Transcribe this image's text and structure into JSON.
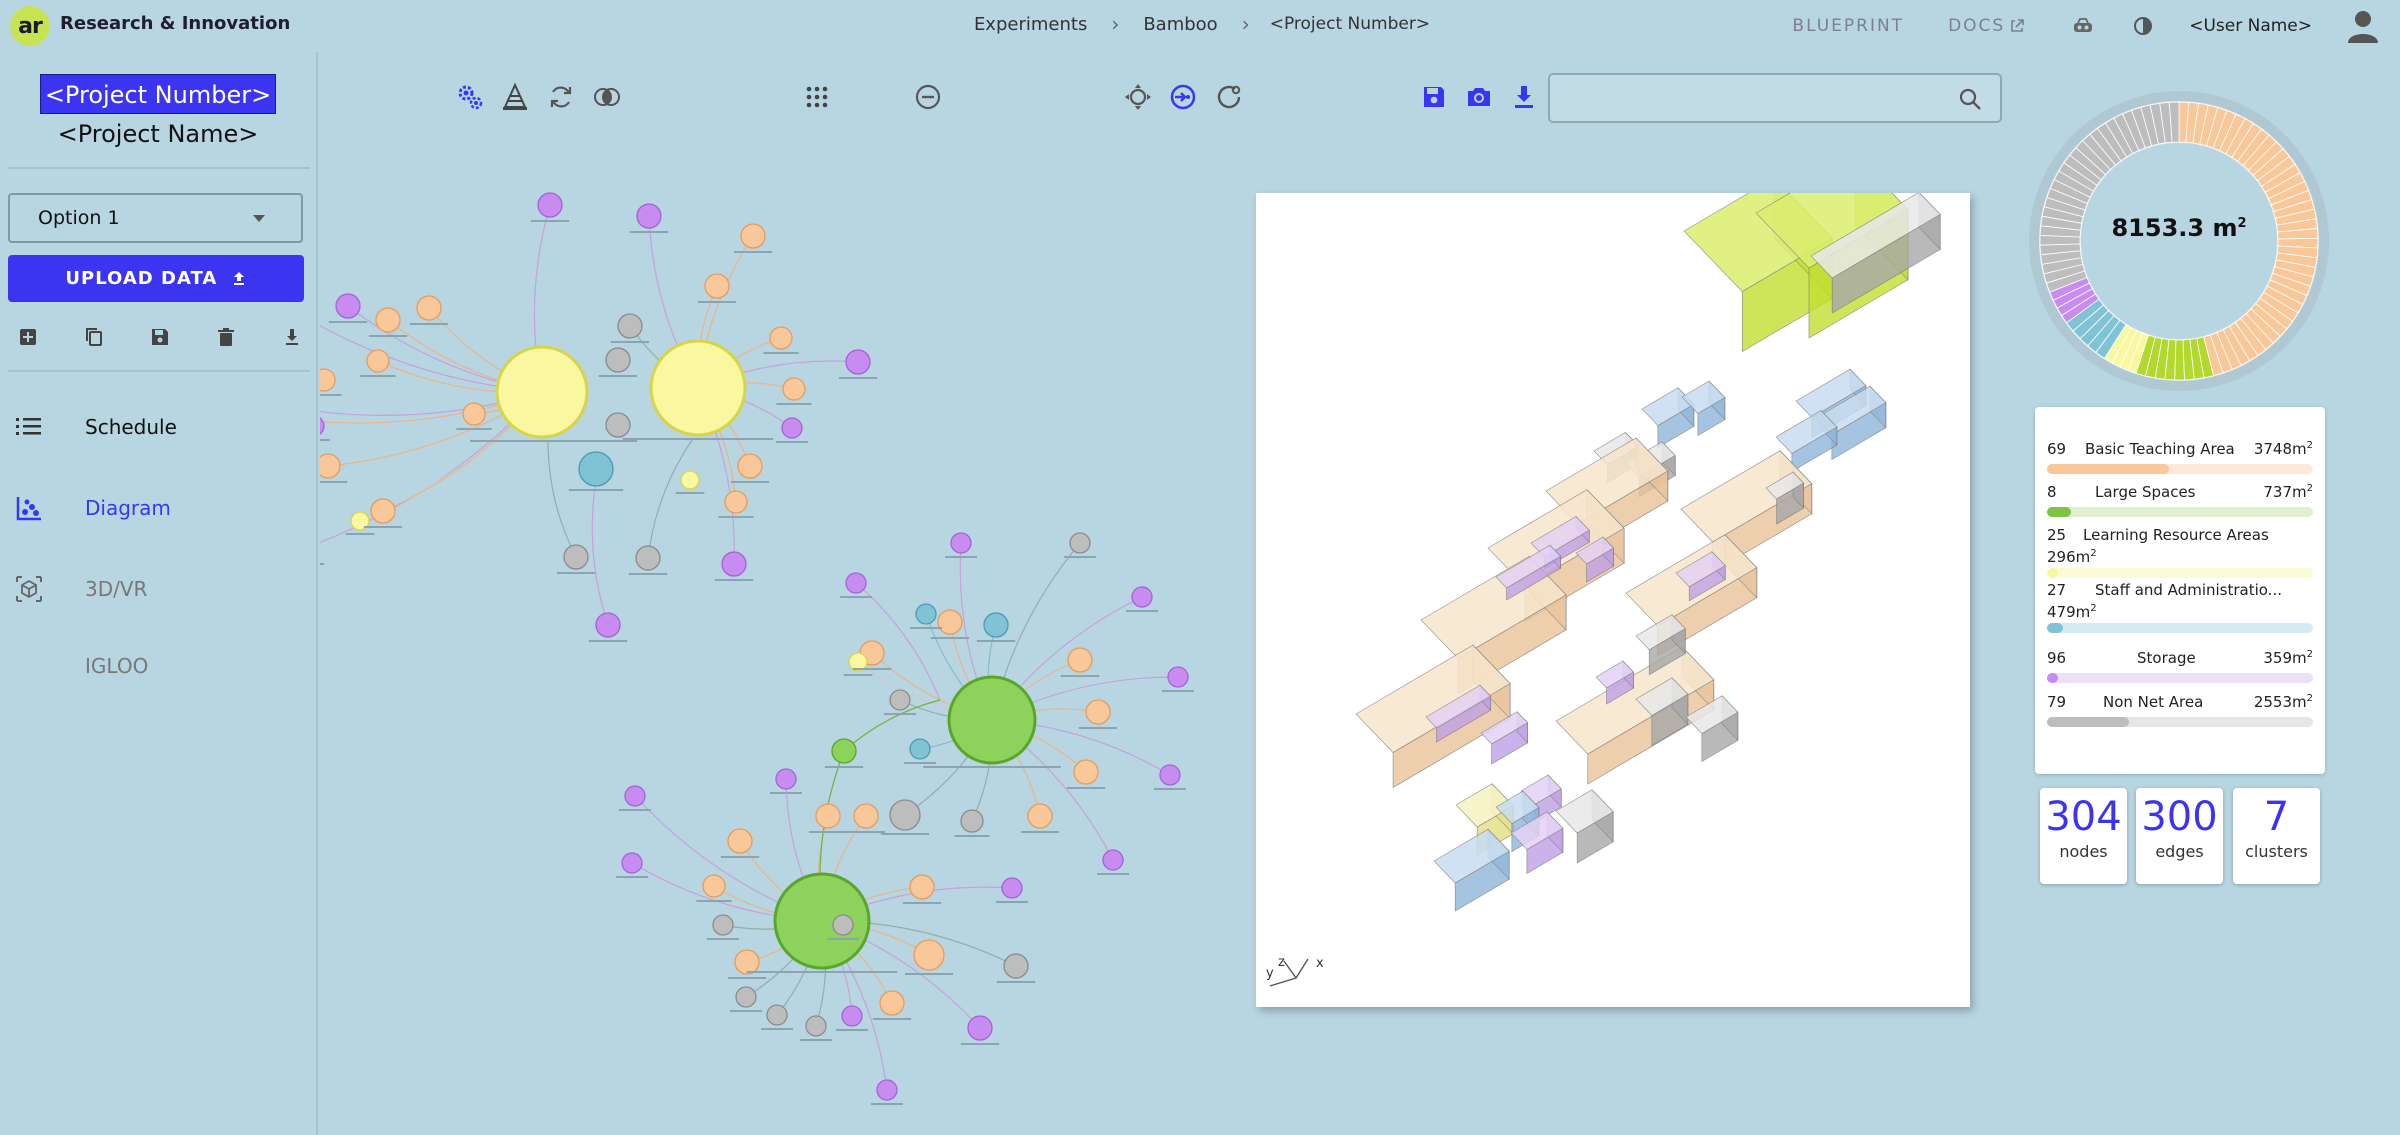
{
  "header": {
    "logo_text": "ar",
    "app_title": "Research & Innovation",
    "breadcrumb": [
      "Experiments",
      "Bamboo",
      "<Project Number>"
    ],
    "links": [
      "BLUEPRINT",
      "DOCS"
    ],
    "user_name": "<User Name>"
  },
  "sidebar": {
    "project_number": "<Project Number>",
    "project_name": "<Project Name>",
    "option_selected": "Option 1",
    "upload_label": "UPLOAD DATA",
    "nav": [
      {
        "label": "Schedule",
        "icon": "list-icon",
        "active": false
      },
      {
        "label": "Diagram",
        "icon": "scatter-diagram-icon",
        "active": true
      },
      {
        "label": "3D/VR",
        "icon": "cube-icon",
        "active": false
      },
      {
        "label": "IGLOO",
        "icon": "",
        "active": false
      }
    ]
  },
  "search": {
    "placeholder": "",
    "value": ""
  },
  "summary": {
    "total_area": "8153.3 m",
    "categories": [
      {
        "count": "69",
        "name": "Basic Teaching Area",
        "area": "3748m",
        "fraction": 0.46,
        "color": "#f8c89a",
        "track": "#fce9d8"
      },
      {
        "count": "8",
        "name": "Large Spaces",
        "area": "737m",
        "fraction": 0.09,
        "color": "#7dc542",
        "track": "#dff0cf"
      },
      {
        "count": "25",
        "name": "Learning Resource Areas",
        "area": "296m",
        "fraction": 0.04,
        "color": "#f9f7a0",
        "track": "#fbfbd8"
      },
      {
        "count": "27",
        "name": "Staff and Administratio...",
        "area": "479m",
        "fraction": 0.06,
        "color": "#7fc3d4",
        "track": "#d3ebf1"
      },
      {
        "count": "96",
        "name": "Storage",
        "area": "359m",
        "fraction": 0.04,
        "color": "#c88cf0",
        "track": "#ece0f7"
      },
      {
        "count": "79",
        "name": "Non Net Area",
        "area": "2553m",
        "fraction": 0.31,
        "color": "#bdbdbd",
        "track": "#e6e6e6"
      }
    ]
  },
  "stats": [
    {
      "value": "304",
      "label": "nodes"
    },
    {
      "value": "300",
      "label": "edges"
    },
    {
      "value": "7",
      "label": "clusters"
    }
  ],
  "colors": {
    "accent": "#3b35f2",
    "teaching": "#f8c89a",
    "large": "#b3d82f",
    "learning": "#f9f7a0",
    "staff": "#7fc3d4",
    "storage": "#c88cf0",
    "nonnet": "#bdbdbd"
  },
  "viewport_axes": [
    "y",
    "z",
    "x"
  ]
}
